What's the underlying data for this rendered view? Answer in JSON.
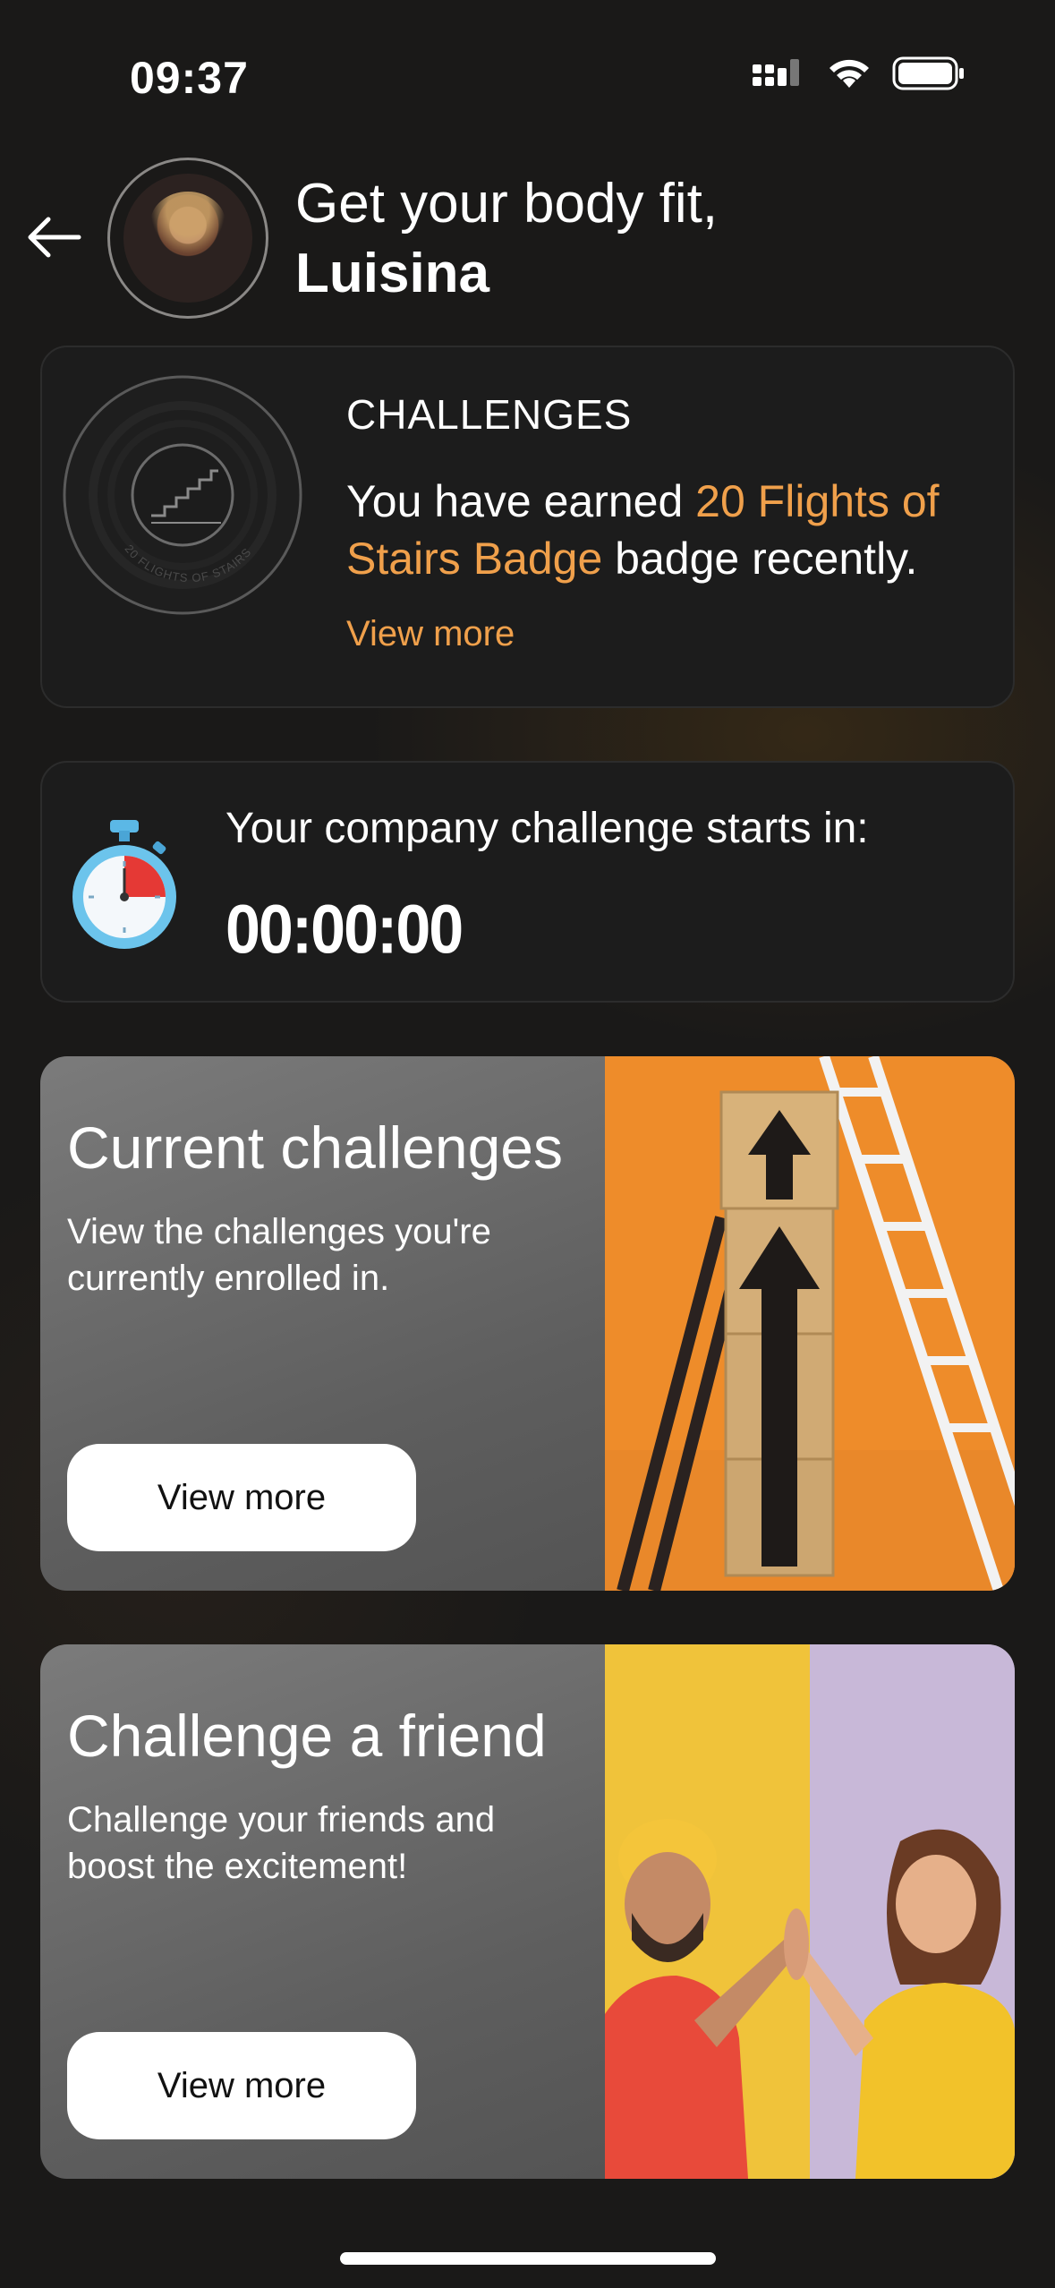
{
  "status_bar": {
    "time": "09:37"
  },
  "header": {
    "greeting": "Get your body fit,",
    "user_name": "Luisina"
  },
  "challenges_card": {
    "title": "CHALLENGES",
    "earned_prefix": "You have earned ",
    "badge_name": "20 Flights of Stairs Badge",
    "earned_suffix": " badge recently.",
    "view_more": "View more",
    "badge_caption": "20 FLIGHTS OF STAIRS"
  },
  "timer_card": {
    "label": "Your company challenge starts in:",
    "countdown": "00:00:00"
  },
  "current_challenges": {
    "title": "Current challenges",
    "description": "View the challenges you're currently enrolled in.",
    "button": "View more"
  },
  "challenge_friend": {
    "title": "Challenge a friend",
    "description": "Challenge your friends and boost the excitement!",
    "button": "View more"
  },
  "colors": {
    "background": "#1a1918",
    "accent": "#f0a04b",
    "card": "#1c1c1c"
  },
  "icons": {
    "back": "arrow-left-icon",
    "signal": "cellular-signal-icon",
    "wifi": "wifi-icon",
    "battery": "battery-icon",
    "stopwatch": "stopwatch-icon",
    "badge": "stairs-badge-icon"
  }
}
